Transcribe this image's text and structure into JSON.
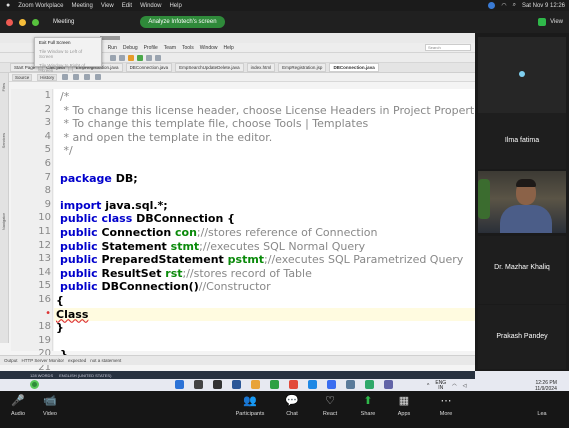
{
  "mac_menubar": {
    "apple": "",
    "app": "Zoom Workplace",
    "items": [
      "Meeting",
      "View",
      "Edit",
      "Window",
      "Help"
    ],
    "clock": "Sat Nov 9 12:26"
  },
  "meeting_bar": {
    "title": "Meeting",
    "share_pill": "Analyze Infotech's screen",
    "view": "View"
  },
  "ide": {
    "menu": [
      "r",
      "Run",
      "Debug",
      "Profile",
      "Team",
      "Tools",
      "Window",
      "Help"
    ],
    "search_placeholder": "Search",
    "window_menu": {
      "items": [
        "Exit Full Screen",
        "Tile Window to Left of Screen",
        "Tile Window to Right of Screen"
      ]
    },
    "tabs": [
      "Start Page",
      "Calc.java",
      "EmpRegistration.java",
      "DBConnection.java",
      "EmpSearchUpdateDelete.java",
      "index.html",
      "EmpRegistration.jsp",
      "DBConnection.java"
    ],
    "subbar": {
      "source": "Source",
      "history": "History"
    },
    "side_labels": [
      "Files",
      "Services",
      "Navigator"
    ],
    "lines": [
      {
        "n": "1",
        "text": "/*"
      },
      {
        "n": "2",
        "text": " * To change this license header, choose License Headers in Project Properties."
      },
      {
        "n": "3",
        "text": " * To change this template file, choose Tools | Templates"
      },
      {
        "n": "4",
        "text": " * and open the template in the editor."
      },
      {
        "n": "5",
        "text": " */"
      },
      {
        "n": "6",
        "text": ""
      },
      {
        "n": "7",
        "kw": "package",
        "rest": " DB;"
      },
      {
        "n": "8",
        "text": ""
      },
      {
        "n": "9",
        "kw": "import",
        "rest": " java.sql.*;"
      },
      {
        "n": "10",
        "kw": "public class",
        "rest": " DBConnection {"
      },
      {
        "n": "11",
        "kw": "public",
        "type": " Connection",
        "field": " con",
        "cmt": ";//stores reference of Connection"
      },
      {
        "n": "12",
        "kw": "public",
        "type": " Statement",
        "field": " stmt",
        "cmt": ";//executes SQL Normal Query"
      },
      {
        "n": "13",
        "kw": "public",
        "type": " PreparedStatement",
        "field": " pstmt",
        "cmt": ";//executes SQL Parametrized Query"
      },
      {
        "n": "14",
        "kw": "public",
        "type": " ResultSet",
        "field": " rst",
        "cmt": ";//stores record of Table"
      },
      {
        "n": "15",
        "kw": "public",
        "type": " DBConnection()",
        "field": "",
        "cmt": "//Constructor"
      },
      {
        "n": "16",
        "text": "{"
      },
      {
        "n": "•",
        "text": "Class"
      },
      {
        "n": "18",
        "text": "}"
      },
      {
        "n": "19",
        "text": ""
      },
      {
        "n": "20",
        "text": "}"
      },
      {
        "n": "21",
        "text": ""
      }
    ],
    "status": {
      "output": "Output",
      "monitor": "HTTP Server Monitor",
      "expected": "expected",
      "not_stmt": "not a statement"
    }
  },
  "participants": [
    {
      "name": "Ilma fatima"
    },
    {
      "name": "Dr. Mazhar Khaliq"
    },
    {
      "name": "Prakash Pandey"
    }
  ],
  "windows_taskbar": {
    "status_left": "128 WORDS",
    "lang": "ENGLISH (UNITED STATES)",
    "tray_lang": "ENG",
    "tray_region": "IN",
    "time": "12:26 PM",
    "date": "11/9/2024"
  },
  "zoom_controls": [
    {
      "label": "Audio",
      "icon": "🎤"
    },
    {
      "label": "Video",
      "icon": "📹"
    },
    {
      "label": "Participants",
      "icon": "👥"
    },
    {
      "label": "Chat",
      "icon": "💬"
    },
    {
      "label": "React",
      "icon": "♡"
    },
    {
      "label": "Share",
      "icon": "⬆"
    },
    {
      "label": "Apps",
      "icon": "▦"
    },
    {
      "label": "More",
      "icon": "⋯"
    },
    {
      "label": "Lea",
      "icon": ""
    }
  ],
  "colors": {
    "keyword": "#0000cc",
    "field": "#0a8a0a",
    "comment": "#888888",
    "share_pill": "#2f8a3a"
  }
}
